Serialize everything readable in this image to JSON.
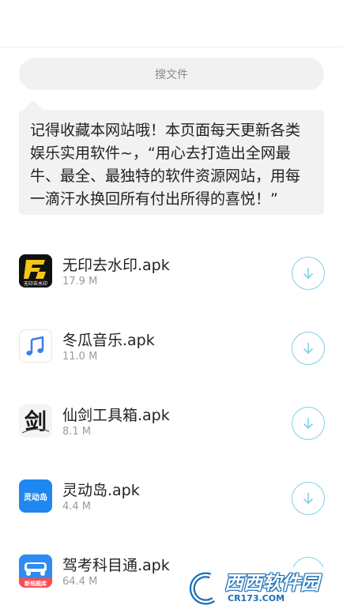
{
  "search": {
    "placeholder": "搜文件"
  },
  "notice": {
    "text": "记得收藏本网站哦！本页面每天更新各类娱乐实用软件~，“用心去打造出全网最牛、最全、最独特的软件资源网站，用每一滴汗水换回所有付出所得的喜悦！”"
  },
  "files": [
    {
      "name": "无印去水印.apk",
      "size": "17.9 M",
      "icon": "no-watermark-app-icon",
      "icon_text": "无印去水印"
    },
    {
      "name": "冬瓜音乐.apk",
      "size": "11.0 M",
      "icon": "music-note-icon"
    },
    {
      "name": "仙剑工具箱.apk",
      "size": "8.1 M",
      "icon": "calligraphy-sword-icon",
      "icon_text": "剑"
    },
    {
      "name": "灵动岛.apk",
      "size": "4.4 M",
      "icon": "dynamic-island-app-icon",
      "icon_text": "灵动岛"
    },
    {
      "name": "驾考科目通.apk",
      "size": "64.4 M",
      "icon": "driving-test-app-icon",
      "icon_text": "新规题库"
    }
  ],
  "watermark": {
    "text": "西西软件园",
    "sub": "CR173.COM"
  },
  "colors": {
    "download_ring": "#7fd0e6",
    "search_bg": "#f1f1f1",
    "notice_bg": "#f2f2f2"
  }
}
